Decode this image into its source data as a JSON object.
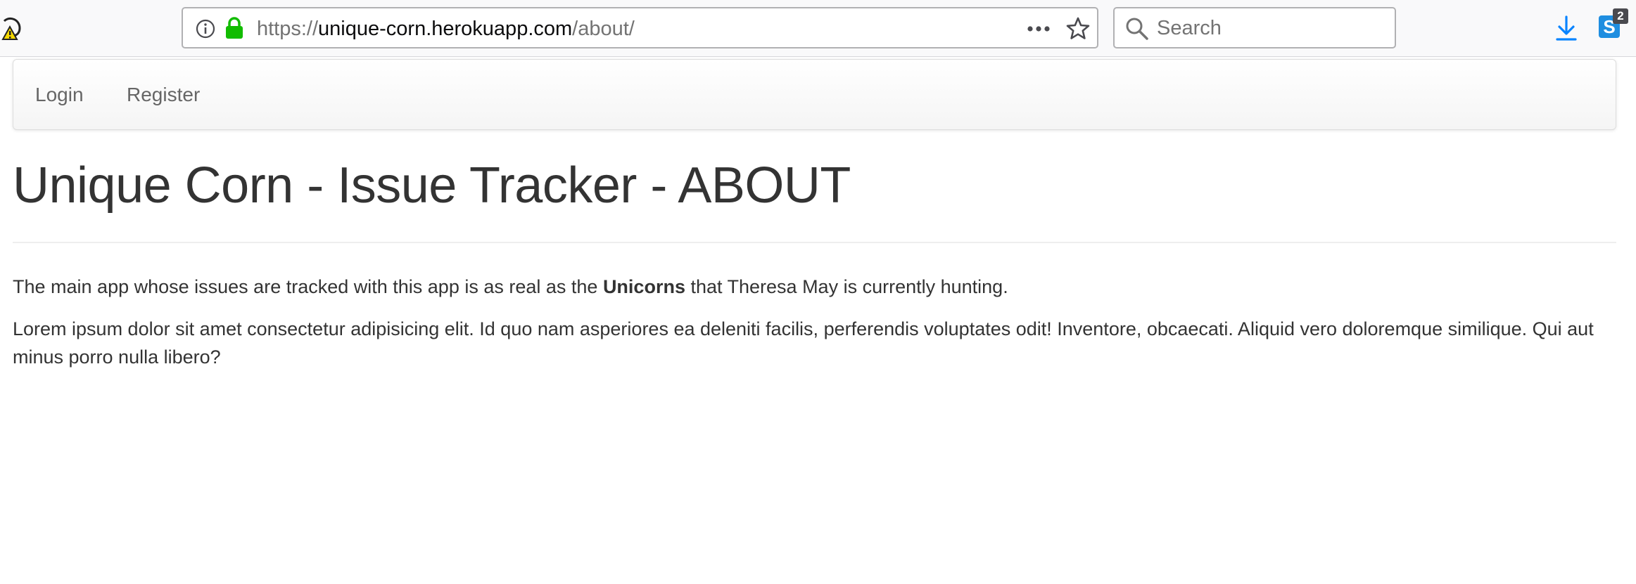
{
  "browser": {
    "url_scheme": "https://",
    "url_host": "unique-corn.herokuapp.com",
    "url_path": "/about/",
    "search_placeholder": "Search",
    "extension_badge_letter": "S",
    "extension_badge_count": "2",
    "icons": {
      "left_extension": "pocket-warning-icon",
      "info": "info-icon",
      "lock": "lock-icon",
      "more": "more-icon",
      "bookmark": "star-icon",
      "search": "search-icon",
      "download": "download-icon"
    },
    "colors": {
      "lock": "#12bc00",
      "download": "#0a84ff",
      "badge_tile": "#1f8ee0"
    }
  },
  "navbar": {
    "items": [
      {
        "label": "Login"
      },
      {
        "label": "Register"
      }
    ]
  },
  "main": {
    "title": "Unique Corn - Issue Tracker - ABOUT",
    "para1_before": "The main app whose issues are tracked with this app is as real as the ",
    "para1_bold": "Unicorns",
    "para1_after": " that Theresa May is currently hunting.",
    "para2": "Lorem ipsum dolor sit amet consectetur adipisicing elit. Id quo nam asperiores ea deleniti facilis, perferendis voluptates odit! Inventore, obcaecati. Aliquid vero doloremque similique. Qui aut minus porro nulla libero?"
  }
}
